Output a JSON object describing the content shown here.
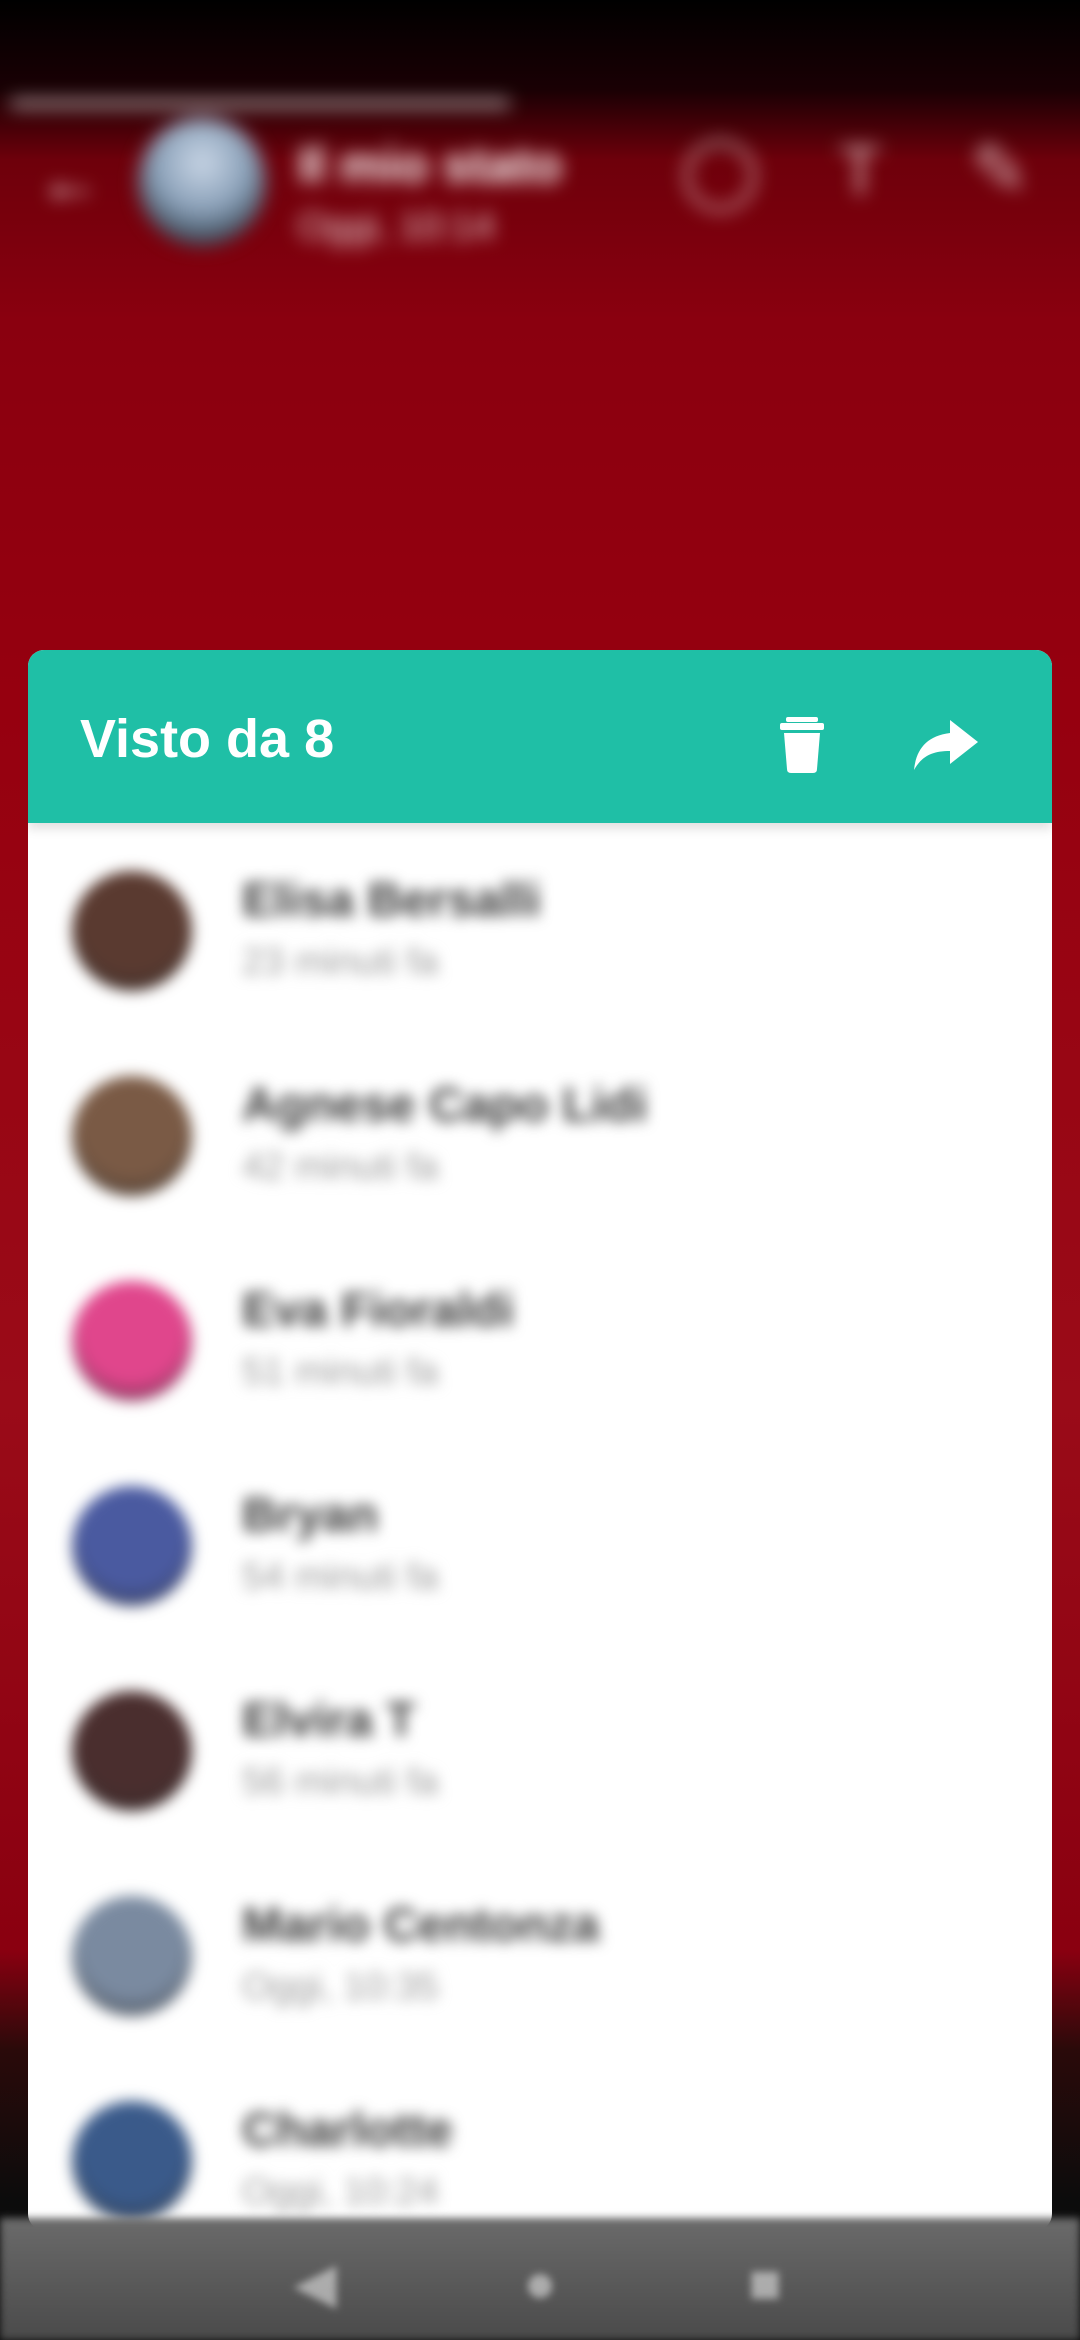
{
  "background": {
    "title": "Il mio stato",
    "subtitle": "Oggi, 10:14",
    "icons": [
      "back-arrow-icon",
      "eye-icon",
      "text-icon",
      "pencil-icon"
    ]
  },
  "dialog": {
    "title": "Visto da 8",
    "delete_icon": "trash-icon",
    "forward_icon": "forward-icon",
    "accent_color": "#1fbfa6"
  },
  "viewers": [
    {
      "name": "Elisa Bersalli",
      "time": "23 minuti fa",
      "avatar_color": "#5a3a30"
    },
    {
      "name": "Agnese Capo Lidi",
      "time": "42 minuti fa",
      "avatar_color": "#7a5a45"
    },
    {
      "name": "Eva Fioraldi",
      "time": "51 minuti fa",
      "avatar_color": "#e0468c"
    },
    {
      "name": "Bryan",
      "time": "54 minuti fa",
      "avatar_color": "#4a5aa0"
    },
    {
      "name": "Elvira T",
      "time": "56 minuti fa",
      "avatar_color": "#4a2e2e"
    },
    {
      "name": "Mario Centonza",
      "time": "Oggi, 10:35",
      "avatar_color": "#7a8aa0"
    },
    {
      "name": "Charlotte",
      "time": "Oggi, 10:24",
      "avatar_color": "#3a5a8a"
    }
  ],
  "navbar": {
    "icons": [
      "back-icon",
      "home-icon",
      "recents-icon"
    ]
  }
}
